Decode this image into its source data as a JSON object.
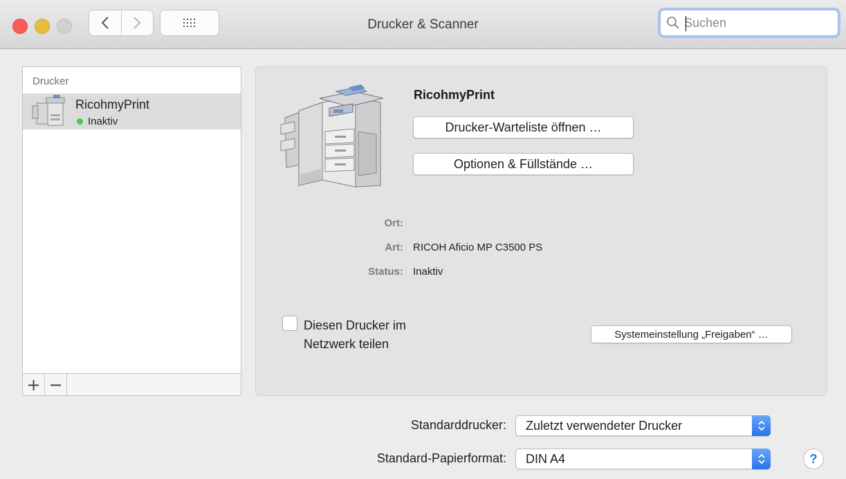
{
  "window": {
    "title": "Drucker & Scanner"
  },
  "search": {
    "placeholder": "Suchen",
    "value": ""
  },
  "sidebar": {
    "header": "Drucker",
    "items": [
      {
        "name": "RicohmyPrint",
        "status": "Inaktiv",
        "status_color": "#3fcd4d"
      }
    ],
    "add_label": "+",
    "remove_label": "−"
  },
  "details": {
    "name": "RicohmyPrint",
    "queue_button": "Drucker-Warteliste öffnen …",
    "options_button": "Optionen & Füllstände …",
    "location_label": "Ort:",
    "location_value": "",
    "type_label": "Art:",
    "type_value": "RICOH Aficio MP C3500 PS",
    "status_label": "Status:",
    "status_value": "Inaktiv",
    "share_checkbox_label": "Diesen Drucker im Netzwerk teilen",
    "share_checked": false,
    "sharing_prefs_button": "Systemeinstellung „Freigaben“ …"
  },
  "defaults": {
    "printer_label": "Standarddrucker:",
    "printer_value": "Zuletzt verwendeter Drucker",
    "paper_label": "Standard-Papierformat:",
    "paper_value": "DIN A4"
  },
  "help_label": "?",
  "colors": {
    "accent": "#2a73e6",
    "close": "#fc5b57",
    "minimize": "#e5bf3c",
    "zoom_disabled": "#d0d0d0"
  }
}
